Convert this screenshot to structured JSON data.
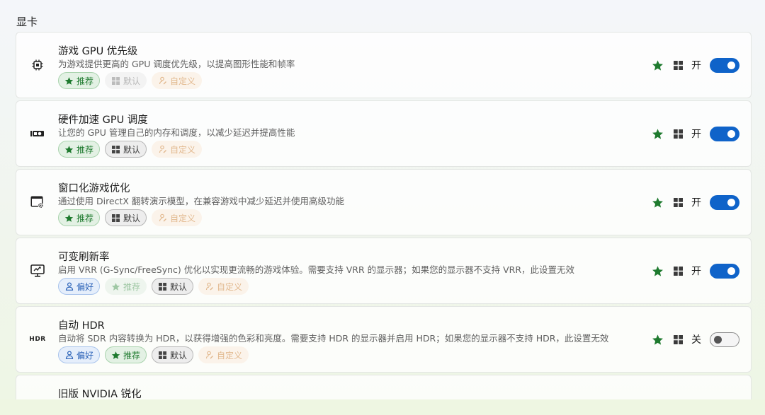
{
  "section_title": "显卡",
  "colors": {
    "accent": "#0f63c9",
    "recommend_green": "#1e7a2e",
    "prefer_blue": "#2c63b8",
    "custom_orange": "#e2b98f"
  },
  "cards": [
    {
      "icon": "cpu-chip-icon",
      "title": "游戏 GPU 优先级",
      "desc": "为游戏提供更高的 GPU 调度优先级，以提高图形性能和帧率",
      "chips": {
        "recommend": "推荐",
        "default": "默认",
        "custom": "自定义"
      },
      "state": "开"
    },
    {
      "icon": "gpu-card-icon",
      "title": "硬件加速 GPU 调度",
      "desc": "让您的 GPU 管理自己的内存和调度，以减少延迟并提高性能",
      "chips": {
        "recommend": "推荐",
        "default": "默认",
        "custom": "自定义"
      },
      "state": "开"
    },
    {
      "icon": "window-settings-icon",
      "title": "窗口化游戏优化",
      "desc": "通过使用 DirectX 翻转演示模型，在兼容游戏中减少延迟并使用高级功能",
      "chips": {
        "recommend": "推荐",
        "default": "默认",
        "custom": "自定义"
      },
      "state": "开"
    },
    {
      "icon": "monitor-refresh-icon",
      "title": "可变刷新率",
      "desc": "启用 VRR (G-Sync/FreeSync) 优化以实现更流畅的游戏体验。需要支持 VRR 的显示器；如果您的显示器不支持 VRR，此设置无效",
      "chips": {
        "prefer": "偏好",
        "recommend": "推荐",
        "default": "默认",
        "custom": "自定义"
      },
      "state": "开"
    },
    {
      "icon": "hdr-icon",
      "icon_text": "HDR",
      "title": "自动 HDR",
      "desc": "自动将 SDR 内容转换为 HDR，以获得增强的色彩和亮度。需要支持 HDR 的显示器并启用 HDR；如果您的显示器不支持 HDR，此设置无效",
      "chips": {
        "prefer": "偏好",
        "recommend": "推荐",
        "default": "默认",
        "custom": "自定义"
      },
      "state": "关"
    },
    {
      "title": "旧版 NVIDIA 锐化"
    }
  ]
}
